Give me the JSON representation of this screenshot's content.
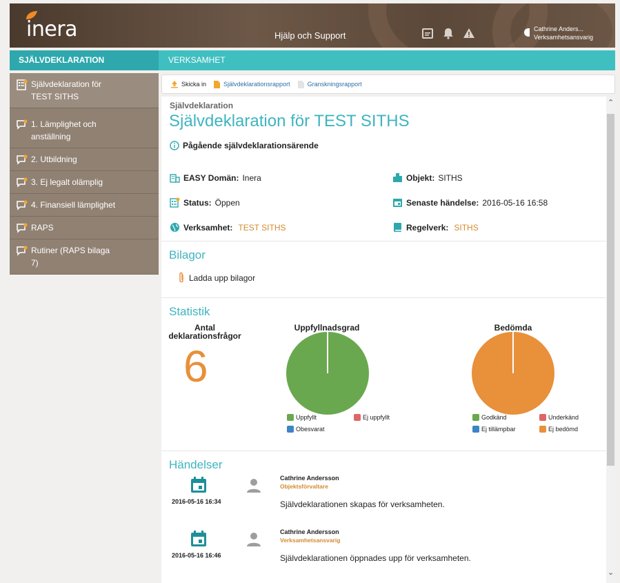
{
  "header": {
    "logo_text": "inera",
    "help_link": "Hjälp och Support",
    "user_name": "Cathrine Anders...",
    "user_role": "Verksamhetsansvarig"
  },
  "nav": {
    "left": "SJÄLVDEKLARATION",
    "right": "VERKSAMHET"
  },
  "sidebar": {
    "items": [
      {
        "label": "Självdeklaration för TEST SITHS",
        "icon": "checklist-icon"
      },
      {
        "label": "1. Lämplighet och anställning",
        "icon": "chat-icon"
      },
      {
        "label": "2. Utbildning",
        "icon": "chat-icon"
      },
      {
        "label": "3. Ej legalt olämplig",
        "icon": "chat-icon"
      },
      {
        "label": "4. Finansiell lämplighet",
        "icon": "chat-icon"
      },
      {
        "label": "RAPS",
        "icon": "chat-icon"
      },
      {
        "label": "Rutiner (RAPS bilaga 7)",
        "icon": "chat-icon"
      }
    ]
  },
  "breadcrumbs": {
    "submit": "Skicka in",
    "report1": "Självdeklarationsrapport",
    "report2": "Granskningsrapport"
  },
  "main": {
    "kicker": "Självdeklaration",
    "title": "Självdeklaration för TEST SITHS",
    "ongoing": "Pågående självdeklarationsärende",
    "fields": {
      "domain_label": "EASY Domän:",
      "domain_value": "Inera",
      "object_label": "Objekt:",
      "object_value": "SITHS",
      "status_label": "Status:",
      "status_value": "Öppen",
      "latest_label": "Senaste händelse:",
      "latest_value": "2016-05-16 16:58",
      "org_label": "Verksamhet:",
      "org_value": "TEST SITHS",
      "rules_label": "Regelverk:",
      "rules_value": "SITHS"
    },
    "attachments_title": "Bilagor",
    "upload_label": "Ladda upp bilagor",
    "stats_title": "Statistik",
    "count_label": "Antal deklarationsfrågor",
    "count_value": "6",
    "fulfillment_title": "Uppfyllnadsgrad",
    "assessed_title": "Bedömda",
    "events_title": "Händelser"
  },
  "chart_data": [
    {
      "type": "pie",
      "title": "Uppfyllnadsgrad",
      "categories": [
        "Uppfyllt",
        "Ej uppfyllt",
        "Obesvarat"
      ],
      "values": [
        6,
        0,
        0
      ],
      "colors": [
        "#6aa84f",
        "#e06666",
        "#3d85c6"
      ],
      "legend": "bottom"
    },
    {
      "type": "pie",
      "title": "Bedömda",
      "categories": [
        "Godkänd",
        "Underkänd",
        "Ej tillämpbar",
        "Ej bedömd"
      ],
      "values": [
        0,
        0,
        0,
        6
      ],
      "colors": [
        "#6aa84f",
        "#e06666",
        "#3d85c6",
        "#e8903a"
      ],
      "legend": "bottom"
    }
  ],
  "events": [
    {
      "date": "2016-05-16 16:34",
      "name": "Cathrine Andersson",
      "role": "Objektsförvaltare",
      "text": "Självdeklarationen skapas för verksamheten."
    },
    {
      "date": "2016-05-16 16:46",
      "name": "Cathrine Andersson",
      "role": "Verksamhetsansvarig",
      "text": "Självdeklarationen öppnades upp för verksamheten."
    }
  ],
  "colors": {
    "accent": "#3fb4c0",
    "nav": "#40bfc0",
    "sidebar": "#908173",
    "link_orange": "#d48a2e"
  }
}
